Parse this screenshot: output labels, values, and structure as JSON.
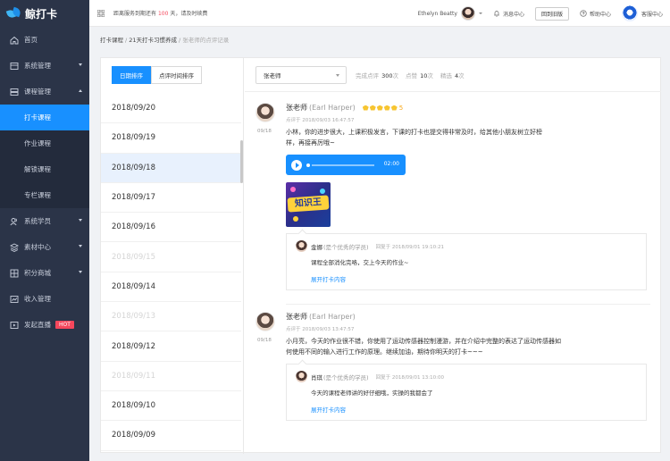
{
  "app": {
    "logo_text": "鲸打卡"
  },
  "sidebar": {
    "items": [
      {
        "label": "首页",
        "icon": "home-icon"
      },
      {
        "label": "系统管理",
        "icon": "system-icon"
      },
      {
        "label": "课程管理",
        "icon": "course-icon"
      },
      {
        "label": "打卡课程"
      },
      {
        "label": "作业课程"
      },
      {
        "label": "解锁课程"
      },
      {
        "label": "专栏课程"
      },
      {
        "label": "系统学员",
        "icon": "students-icon"
      },
      {
        "label": "素材中心",
        "icon": "material-icon"
      },
      {
        "label": "积分商城",
        "icon": "shop-icon"
      },
      {
        "label": "收入管理",
        "icon": "income-icon"
      },
      {
        "label": "发起直播",
        "icon": "live-icon",
        "badge": "HOT"
      }
    ]
  },
  "header": {
    "notice_prefix": "距离服务到期还有",
    "notice_days": "100",
    "notice_suffix": "天，请及时续费",
    "user_name": "Ethelyn Beatty",
    "messages": "消息中心",
    "back_old": "回到旧版",
    "help": "帮助中心",
    "service": "客服中心"
  },
  "breadcrumb": {
    "level1": "打卡课程",
    "level2": "21天打卡习惯养成",
    "current": "张老师的点评记录"
  },
  "sort": {
    "by_date": "日期排序",
    "by_review_time": "点评时间排序"
  },
  "dates": [
    {
      "label": "2018/09/20",
      "state": "normal"
    },
    {
      "label": "2018/09/19",
      "state": "normal"
    },
    {
      "label": "2018/09/18",
      "state": "selected"
    },
    {
      "label": "2018/09/17",
      "state": "normal"
    },
    {
      "label": "2018/09/16",
      "state": "normal"
    },
    {
      "label": "2018/09/15",
      "state": "disabled"
    },
    {
      "label": "2018/09/14",
      "state": "normal"
    },
    {
      "label": "2018/09/13",
      "state": "disabled"
    },
    {
      "label": "2018/09/12",
      "state": "normal"
    },
    {
      "label": "2018/09/11",
      "state": "disabled"
    },
    {
      "label": "2018/09/10",
      "state": "normal"
    },
    {
      "label": "2018/09/09",
      "state": "normal"
    }
  ],
  "filter": {
    "teacher": "张老师",
    "done_label": "完成点评",
    "done_value": "300",
    "done_unit": "次",
    "like_label": "点赞",
    "like_value": "10",
    "like_unit": "次",
    "pick_label": "精选",
    "pick_value": "4",
    "pick_unit": "次"
  },
  "comments": [
    {
      "date": "09/18",
      "name": "张老师",
      "en_name": "(Earl Harper)",
      "stars": 5,
      "star_num": "5",
      "meta": "点评于 2018/09/03 16:47:57",
      "text": "小林，你的进步很大，上课积极发言，下课的打卡也提交得非常及时，给其他小朋友树立好榜样，再接再厉哦~",
      "audio_time": "02:00",
      "image_text": "知识王",
      "reply": {
        "name": "金娜",
        "role": "(是个优秀的学员)",
        "time": "回复于 2018/09/01 19:10:21",
        "text": "课程全部消化完咯，交上今天的作业~",
        "link": "展开打卡内容"
      }
    },
    {
      "date": "09/18",
      "name": "张老师",
      "en_name": "(Earl Harper)",
      "meta": "点评于 2018/09/03 13:47:57",
      "text": "小月亮，今天的作业很不错，你使用了运动传感器控制漫游，并在介绍中完整的表达了运动传感器如何使用不同的输入进行工作的原理。继续加油，期待你明天的打卡~~~",
      "reply": {
        "name": "肖琪",
        "role": "(是个优秀的学员)",
        "time": "回复于 2018/09/01 13:10:00",
        "text": "今天的课程老师讲的好仔细哦，实操的我都会了",
        "link": "展开打卡内容"
      }
    }
  ]
}
